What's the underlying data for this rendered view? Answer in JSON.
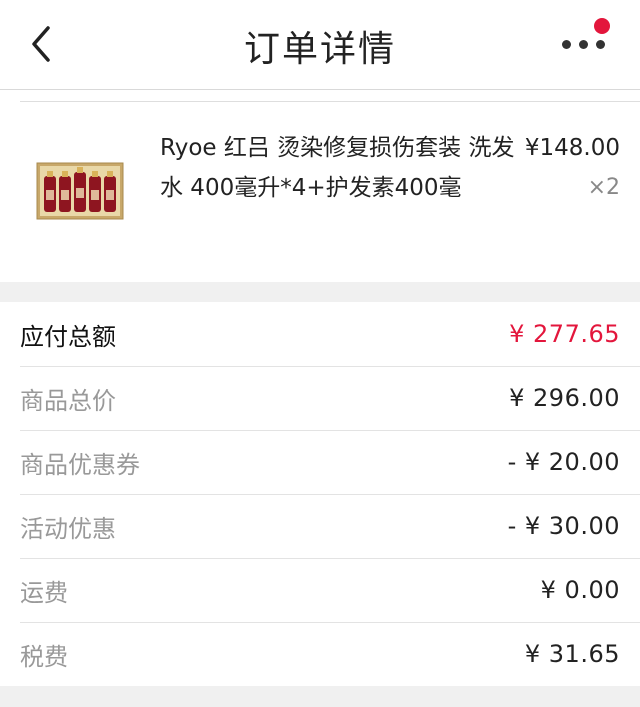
{
  "nav": {
    "title": "订单详情",
    "back_icon": "chevron-left-icon",
    "more_icon": "more-dots-icon",
    "notification_color": "#e3163c"
  },
  "product": {
    "name": "Ryoe 红吕 烫染修复损伤套装 洗发水 400毫升*4+护发素400毫",
    "price": "¥148.00",
    "quantity": "×2"
  },
  "summary": {
    "rows": [
      {
        "label": "应付总额",
        "value": "¥ 277.65"
      },
      {
        "label": "商品总价",
        "value": "¥ 296.00"
      },
      {
        "label": "商品优惠券",
        "value": "- ¥ 20.00"
      },
      {
        "label": "活动优惠",
        "value": "- ¥ 30.00"
      },
      {
        "label": "运费",
        "value": "¥ 0.00"
      },
      {
        "label": "税费",
        "value": "¥ 31.65"
      }
    ]
  },
  "colors": {
    "accent": "#e3163c",
    "divider": "#f0f0f0"
  }
}
